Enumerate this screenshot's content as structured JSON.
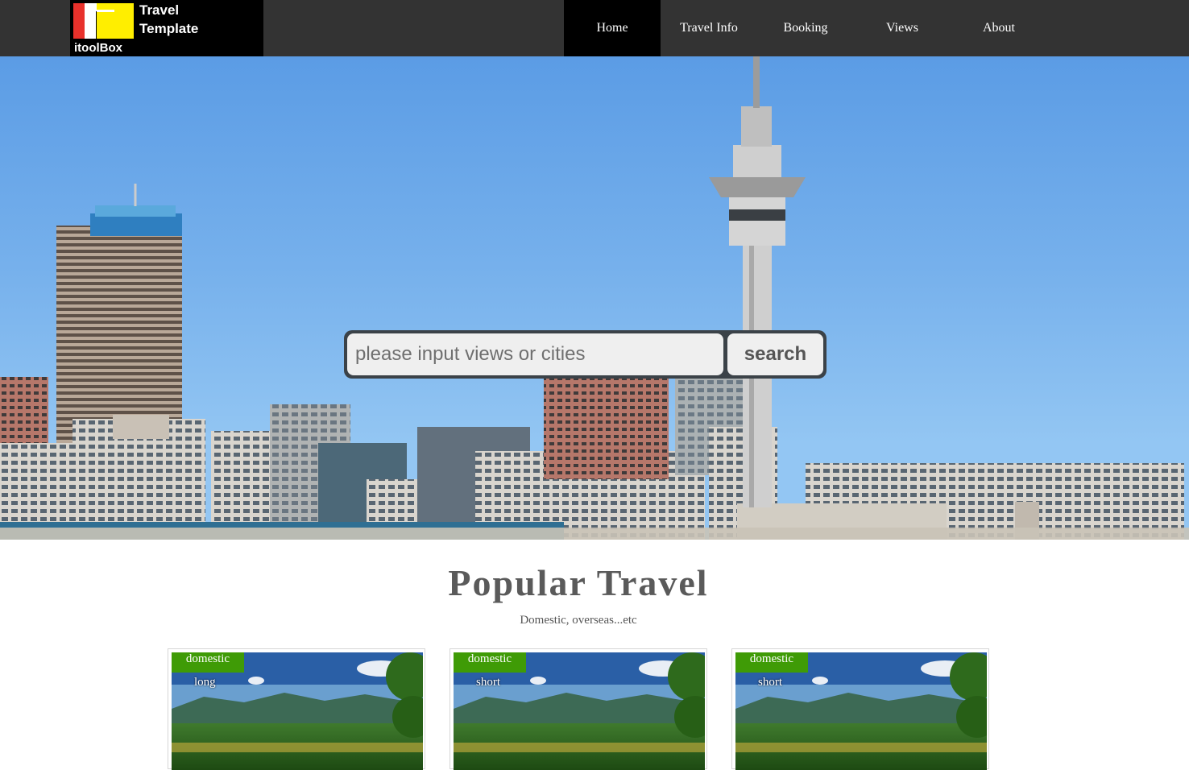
{
  "brand": {
    "line1": "Travel",
    "line2": "Template",
    "line3": "itoolBox"
  },
  "nav": {
    "items": [
      {
        "label": "Home",
        "active": true
      },
      {
        "label": "Travel Info"
      },
      {
        "label": "Booking"
      },
      {
        "label": "Views"
      },
      {
        "label": "About"
      }
    ]
  },
  "search": {
    "placeholder": "please input views or cities",
    "button": "search"
  },
  "popular": {
    "title": "Popular Travel",
    "subtitle": "Domestic, overseas...etc",
    "cards": [
      {
        "tag": "domestic",
        "subtag": "long"
      },
      {
        "tag": "domestic",
        "subtag": "short"
      },
      {
        "tag": "domestic",
        "subtag": "short"
      }
    ]
  },
  "colors": {
    "header_bg": "#333333",
    "active_nav": "#000000",
    "tag_green": "#3f9b06",
    "logo_red": "#e8312b",
    "logo_yellow": "#ffee00"
  }
}
